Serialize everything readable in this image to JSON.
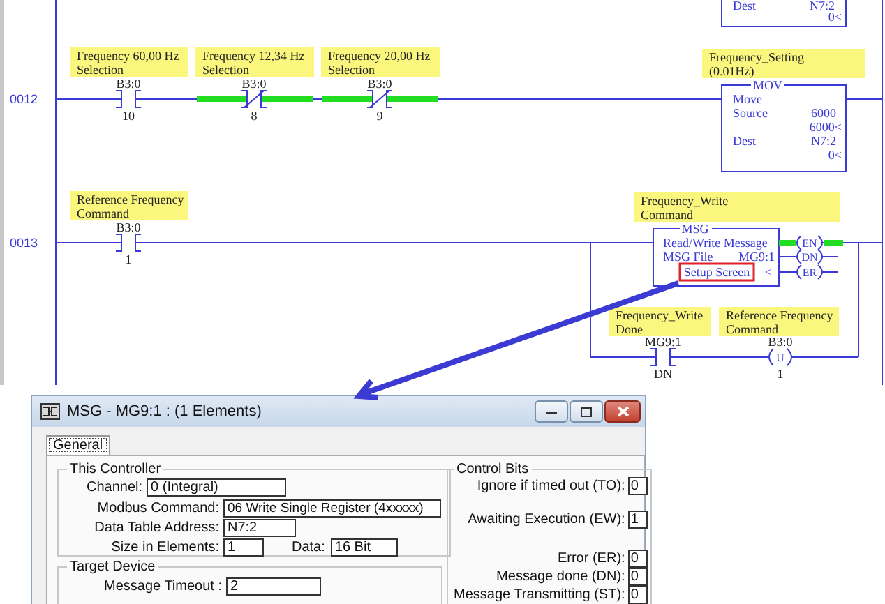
{
  "ladder": {
    "top_instruction": {
      "dest_label": "Dest",
      "dest_address": "N7:2",
      "dest_value": "0<"
    },
    "rungs": [
      {
        "number": "0012",
        "contacts": [
          {
            "kind": "no",
            "comment": [
              "Frequency 60,00 Hz",
              "Selection"
            ],
            "address": "B3:0",
            "bit": "10",
            "energized": false
          },
          {
            "kind": "nc",
            "comment": [
              "Frequency 12,34 Hz",
              "Selection"
            ],
            "address": "B3:0",
            "bit": "8",
            "energized": true
          },
          {
            "kind": "nc",
            "comment": [
              "Frequency 20,00 Hz",
              "Selection"
            ],
            "address": "B3:0",
            "bit": "9",
            "energized": true
          }
        ],
        "instruction": {
          "kind": "mov",
          "comment": [
            "Frequency_Setting",
            "(0.01Hz)"
          ],
          "title": "MOV",
          "description": "Move",
          "rows": [
            {
              "label": "Source",
              "value": "6000",
              "live_value": "6000<"
            },
            {
              "label": "Dest",
              "value": "N7:2",
              "live_value": "0<"
            }
          ]
        }
      },
      {
        "number": "0013",
        "contacts": [
          {
            "kind": "no",
            "comment": [
              "Reference Frequency",
              "Command"
            ],
            "address": "B3:0",
            "bit": "1",
            "energized": false
          }
        ],
        "instruction": {
          "kind": "msg",
          "comment": [
            "Frequency_Write",
            "Command"
          ],
          "title": "MSG",
          "description": "Read/Write Message",
          "file_label": "MSG File",
          "file": "MG9:1",
          "setup_button": "Setup Screen",
          "marker": "<",
          "outputs": [
            {
              "label": "EN",
              "energized": true
            },
            {
              "label": "DN",
              "energized": false
            },
            {
              "label": "ER",
              "energized": false
            }
          ]
        },
        "branch": [
          {
            "kind": "no",
            "comment": [
              "Frequency_Write",
              "Done"
            ],
            "address": "MG9:1",
            "bit": "DN",
            "energized": false
          },
          {
            "kind": "unlatch",
            "comment": [
              "Reference Frequency",
              "Command"
            ],
            "address": "B3:0",
            "bit": "1",
            "symbol": "U"
          }
        ]
      }
    ]
  },
  "dialog": {
    "title": "MSG - MG9:1 : (1 Elements)",
    "tabs": [
      {
        "label": "General",
        "selected": true
      }
    ],
    "this_controller": {
      "title": "This Controller",
      "fields": [
        {
          "label": "Channel:",
          "value": "0 (Integral)"
        },
        {
          "label": "Modbus Command:",
          "value": "06 Write Single Register (4xxxxx)"
        },
        {
          "label": "Data Table Address:",
          "value": "N7:2"
        },
        {
          "label": "Size in Elements:",
          "value": "1"
        },
        {
          "label": "Data:",
          "value": "16 Bit"
        }
      ]
    },
    "target_device": {
      "title": "Target Device",
      "fields": [
        {
          "label": "Message Timeout :",
          "value": "2"
        }
      ]
    },
    "control_bits": {
      "title": "Control Bits",
      "bits": [
        {
          "label": "Ignore if timed out (TO):",
          "value": "0"
        },
        {
          "label": "Awaiting Execution (EW):",
          "value": "1"
        },
        {
          "label": "Error (ER):",
          "value": "0"
        },
        {
          "label": "Message done (DN):",
          "value": "0"
        },
        {
          "label": "Message Transmitting (ST):",
          "value": "0"
        }
      ]
    }
  }
}
